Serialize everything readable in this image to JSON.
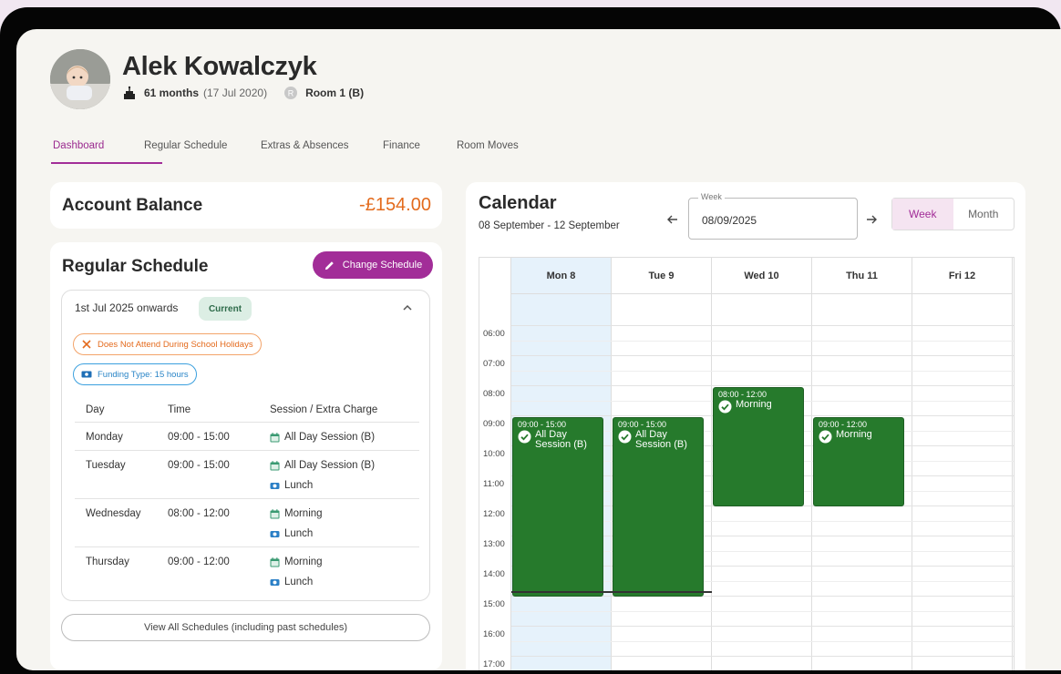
{
  "child": {
    "name": "Alek Kowalczyk",
    "age": "61 months",
    "dob": "(17 Jul 2020)",
    "room": "Room 1 (B)"
  },
  "tabs": [
    {
      "label": "Dashboard",
      "active": true
    },
    {
      "label": "Regular Schedule",
      "active": false
    },
    {
      "label": "Extras & Absences",
      "active": false
    },
    {
      "label": "Finance",
      "active": false
    },
    {
      "label": "Room Moves",
      "active": false
    }
  ],
  "balance": {
    "title": "Account Balance",
    "amount": "-£154.00",
    "amount_color": "#e36b1d"
  },
  "schedule": {
    "title": "Regular Schedule",
    "change_label": "Change Schedule",
    "from_label": "1st Jul 2025 onwards",
    "status_badge": "Current",
    "holiday_note": "Does Not Attend During School Holidays",
    "funding_note": "Funding Type: 15 hours",
    "headers": {
      "day": "Day",
      "time": "Time",
      "session": "Session / Extra Charge"
    },
    "rows": [
      {
        "day": "Monday",
        "time": "09:00 - 15:00",
        "sessions": [
          {
            "icon": "calendar-icon",
            "label": "All Day Session (B)"
          }
        ]
      },
      {
        "day": "Tuesday",
        "time": "09:00 - 15:00",
        "sessions": [
          {
            "icon": "calendar-icon",
            "label": "All Day Session (B)"
          },
          {
            "icon": "meal-icon",
            "label": "Lunch"
          }
        ]
      },
      {
        "day": "Wednesday",
        "time": "08:00 - 12:00",
        "sessions": [
          {
            "icon": "calendar-icon",
            "label": "Morning"
          },
          {
            "icon": "meal-icon",
            "label": "Lunch"
          }
        ]
      },
      {
        "day": "Thursday",
        "time": "09:00 - 12:00",
        "sessions": [
          {
            "icon": "calendar-icon",
            "label": "Morning"
          },
          {
            "icon": "meal-icon",
            "label": "Lunch"
          }
        ]
      }
    ],
    "view_all_label": "View All Schedules (including past schedules)"
  },
  "calendar": {
    "title": "Calendar",
    "range": "08 September - 12 September",
    "week_label": "Week",
    "week_value": "08/09/2025",
    "view_week": "Week",
    "view_month": "Month",
    "days": [
      "Mon 8",
      "Tue 9",
      "Wed 10",
      "Thu 11",
      "Fri 12"
    ],
    "hours": [
      "06:00",
      "07:00",
      "08:00",
      "09:00",
      "10:00",
      "11:00",
      "12:00",
      "13:00",
      "14:00",
      "15:00",
      "16:00",
      "17:00"
    ],
    "events": [
      {
        "day": 0,
        "start": "09:00",
        "end": "15:00",
        "time_label": "09:00 - 15:00",
        "name": "All Day Session (B)"
      },
      {
        "day": 1,
        "start": "09:00",
        "end": "15:00",
        "time_label": "09:00 - 15:00",
        "name": "All Day Session (B)"
      },
      {
        "day": 2,
        "start": "08:00",
        "end": "12:00",
        "time_label": "08:00 - 12:00",
        "name": "Morning"
      },
      {
        "day": 3,
        "start": "09:00",
        "end": "12:00",
        "time_label": "09:00 - 12:00",
        "name": "Morning"
      }
    ],
    "event_color": "#267a2c",
    "accent": "#a22d98"
  }
}
